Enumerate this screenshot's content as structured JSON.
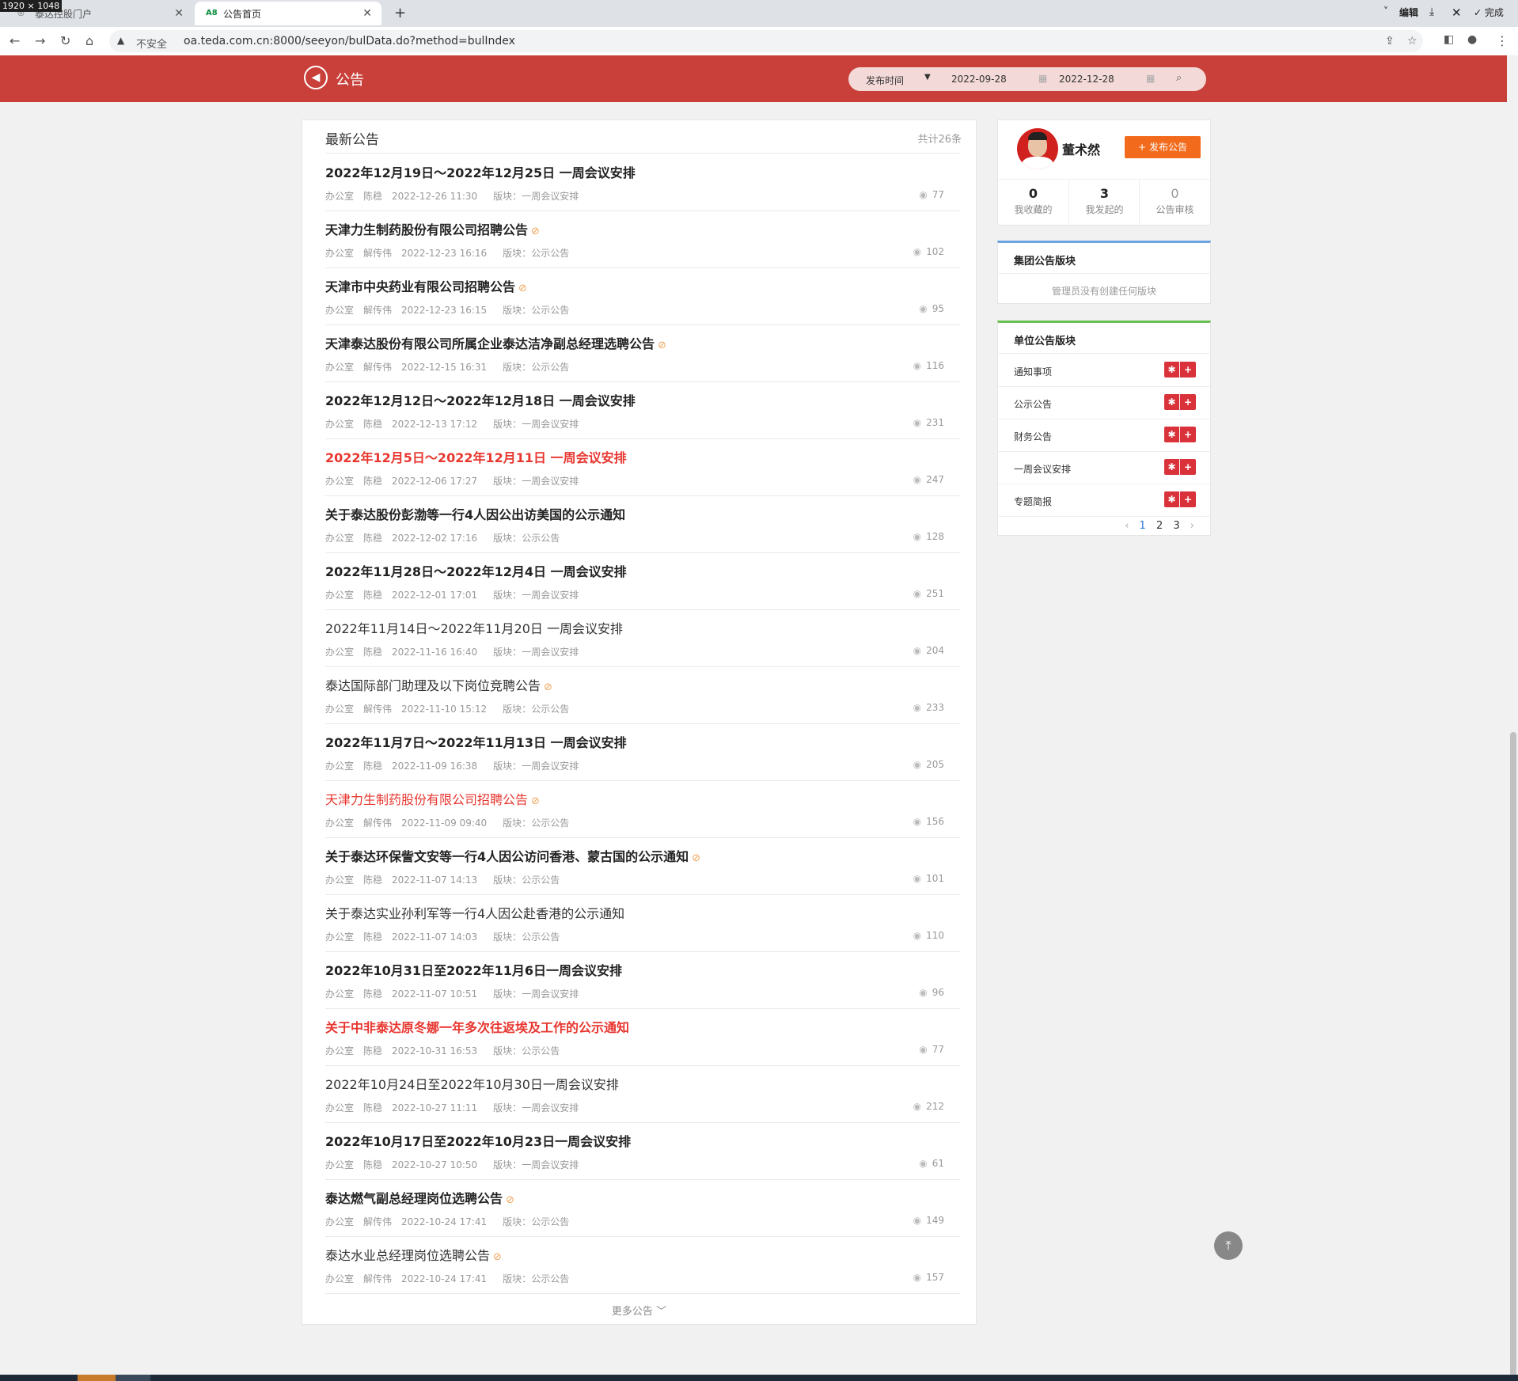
{
  "screen_label": "1920 × 1048",
  "browser": {
    "tabs": [
      {
        "label": "泰达控股门户"
      },
      {
        "label": "公告首页"
      }
    ],
    "toolbar_right": [
      "编辑",
      "完成"
    ],
    "insecure_label": "不安全",
    "url": "oa.teda.com.cn:8000/seeyon/bulData.do?method=bulIndex"
  },
  "header": {
    "title": "公告",
    "search": {
      "type_label": "发布时间",
      "date_from": "2022-09-28",
      "date_to": "2022-12-28"
    }
  },
  "list": {
    "title": "最新公告",
    "count": "共计26条",
    "block_prefix": "版块：",
    "more": "更多公告",
    "items": [
      {
        "title": "2022年12月19日～2022年12月25日 一周会议安排",
        "style": "bold",
        "clip": false,
        "dept": "办公室",
        "author": "陈稳",
        "time": "2022-12-26 11:30",
        "block": "一周会议安排",
        "views": "77"
      },
      {
        "title": "天津力生制药股份有限公司招聘公告",
        "style": "bold",
        "clip": true,
        "dept": "办公室",
        "author": "解传伟",
        "time": "2022-12-23 16:16",
        "block": "公示公告",
        "views": "102"
      },
      {
        "title": "天津市中央药业有限公司招聘公告",
        "style": "bold",
        "clip": true,
        "dept": "办公室",
        "author": "解传伟",
        "time": "2022-12-23 16:15",
        "block": "公示公告",
        "views": "95"
      },
      {
        "title": "天津泰达股份有限公司所属企业泰达洁净副总经理选聘公告",
        "style": "bold",
        "clip": true,
        "dept": "办公室",
        "author": "解传伟",
        "time": "2022-12-15 16:31",
        "block": "公示公告",
        "views": "116"
      },
      {
        "title": "2022年12月12日～2022年12月18日 一周会议安排",
        "style": "bold",
        "clip": false,
        "dept": "办公室",
        "author": "陈稳",
        "time": "2022-12-13 17:12",
        "block": "一周会议安排",
        "views": "231"
      },
      {
        "title": "2022年12月5日～2022年12月11日 一周会议安排",
        "style": "red-bold",
        "clip": false,
        "dept": "办公室",
        "author": "陈稳",
        "time": "2022-12-06 17:27",
        "block": "一周会议安排",
        "views": "247"
      },
      {
        "title": "关于泰达股份彭渤等一行4人因公出访美国的公示通知",
        "style": "bold",
        "clip": false,
        "dept": "办公室",
        "author": "陈稳",
        "time": "2022-12-02 17:16",
        "block": "公示公告",
        "views": "128"
      },
      {
        "title": "2022年11月28日～2022年12月4日 一周会议安排",
        "style": "bold",
        "clip": false,
        "dept": "办公室",
        "author": "陈稳",
        "time": "2022-12-01 17:01",
        "block": "一周会议安排",
        "views": "251"
      },
      {
        "title": "2022年11月14日～2022年11月20日 一周会议安排",
        "style": "normal",
        "clip": false,
        "dept": "办公室",
        "author": "陈稳",
        "time": "2022-11-16 16:40",
        "block": "一周会议安排",
        "views": "204"
      },
      {
        "title": "泰达国际部门助理及以下岗位竞聘公告",
        "style": "normal",
        "clip": true,
        "dept": "办公室",
        "author": "解传伟",
        "time": "2022-11-10 15:12",
        "block": "公示公告",
        "views": "233"
      },
      {
        "title": "2022年11月7日～2022年11月13日 一周会议安排",
        "style": "bold",
        "clip": false,
        "dept": "办公室",
        "author": "陈稳",
        "time": "2022-11-09 16:38",
        "block": "一周会议安排",
        "views": "205"
      },
      {
        "title": "天津力生制药股份有限公司招聘公告",
        "style": "red",
        "clip": true,
        "dept": "办公室",
        "author": "解传伟",
        "time": "2022-11-09 09:40",
        "block": "公示公告",
        "views": "156"
      },
      {
        "title": "关于泰达环保訾文安等一行4人因公访问香港、蒙古国的公示通知",
        "style": "bold",
        "clip": true,
        "dept": "办公室",
        "author": "陈稳",
        "time": "2022-11-07 14:13",
        "block": "公示公告",
        "views": "101"
      },
      {
        "title": "关于泰达实业孙利军等一行4人因公赴香港的公示通知",
        "style": "normal",
        "clip": false,
        "dept": "办公室",
        "author": "陈稳",
        "time": "2022-11-07 14:03",
        "block": "公示公告",
        "views": "110"
      },
      {
        "title": "2022年10月31日至2022年11月6日一周会议安排",
        "style": "bold",
        "clip": false,
        "dept": "办公室",
        "author": "陈稳",
        "time": "2022-11-07 10:51",
        "block": "一周会议安排",
        "views": "96"
      },
      {
        "title": "关于中非泰达原冬娜一年多次往返埃及工作的公示通知",
        "style": "red-bold",
        "clip": false,
        "dept": "办公室",
        "author": "陈稳",
        "time": "2022-10-31 16:53",
        "block": "公示公告",
        "views": "77"
      },
      {
        "title": "2022年10月24日至2022年10月30日一周会议安排",
        "style": "normal",
        "clip": false,
        "dept": "办公室",
        "author": "陈稳",
        "time": "2022-10-27 11:11",
        "block": "一周会议安排",
        "views": "212"
      },
      {
        "title": "2022年10月17日至2022年10月23日一周会议安排",
        "style": "bold",
        "clip": false,
        "dept": "办公室",
        "author": "陈稳",
        "time": "2022-10-27 10:50",
        "block": "一周会议安排",
        "views": "61"
      },
      {
        "title": "泰达燃气副总经理岗位选聘公告",
        "style": "bold",
        "clip": true,
        "dept": "办公室",
        "author": "解传伟",
        "time": "2022-10-24 17:41",
        "block": "公示公告",
        "views": "149"
      },
      {
        "title": "泰达水业总经理岗位选聘公告",
        "style": "normal",
        "clip": true,
        "dept": "办公室",
        "author": "解传伟",
        "time": "2022-10-24 17:41",
        "block": "公示公告",
        "views": "157"
      }
    ]
  },
  "user": {
    "name": "董术然",
    "publish_label": "发布公告",
    "stats": [
      {
        "num": "0",
        "label": "我收藏的"
      },
      {
        "num": "3",
        "label": "我发起的"
      },
      {
        "num": "0",
        "label": "公告审核"
      }
    ]
  },
  "group_box": {
    "title": "集团公告版块",
    "empty": "管理员没有创建任何版块"
  },
  "unit_box": {
    "title": "单位公告版块",
    "rows": [
      "通知事项",
      "公示公告",
      "财务公告",
      "一周会议安排",
      "专题简报"
    ],
    "pages": [
      "1",
      "2",
      "3"
    ]
  },
  "colors": {
    "header": "#c9403a",
    "accent_red": "#e8362f",
    "publish": "#f26b1d",
    "clip": "#f0a35a"
  }
}
